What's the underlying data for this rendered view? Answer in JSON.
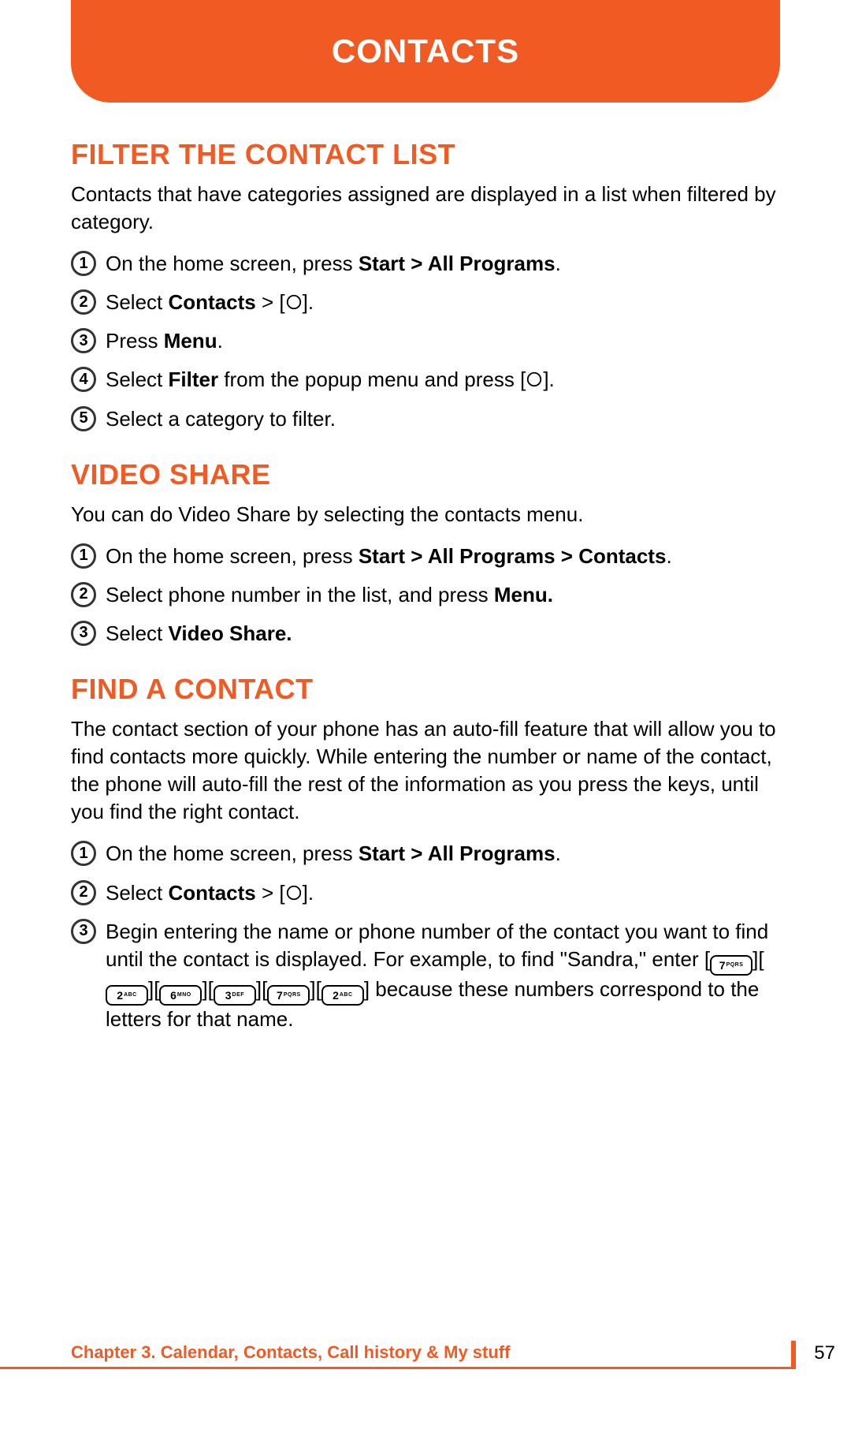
{
  "header": {
    "title": "CONTACTS"
  },
  "sections": [
    {
      "title": "FILTER THE CONTACT LIST",
      "intro": "Contacts that have categories assigned are displayed in a list when filtered by category.",
      "steps": [
        {
          "n": "1",
          "pre": "On the home screen, press ",
          "b1": "Start > All Programs",
          "post": "."
        },
        {
          "n": "2",
          "pre": "Select ",
          "b1": "Contacts",
          "mid": " > [",
          "ok": true,
          "post": "]."
        },
        {
          "n": "3",
          "pre": "Press ",
          "b1": "Menu",
          "post": "."
        },
        {
          "n": "4",
          "pre": "Select ",
          "b1": "Filter",
          "mid": " from the popup menu and press [",
          "ok": true,
          "post": "]."
        },
        {
          "n": "5",
          "pre": "Select a category to filter."
        }
      ]
    },
    {
      "title": "VIDEO SHARE",
      "intro": "You can do Video Share by selecting the contacts menu.",
      "steps": [
        {
          "n": "1",
          "pre": "On the home screen, press ",
          "b1": "Start > All Programs > Contacts",
          "post": "."
        },
        {
          "n": "2",
          "pre": "Select phone number in the list, and press ",
          "b1": "Menu.",
          "post": ""
        },
        {
          "n": "3",
          "pre": "Select ",
          "b1": "Video Share.",
          "post": ""
        }
      ]
    },
    {
      "title": "FIND A CONTACT",
      "intro": "The contact section of your phone has an auto-fill feature that will allow you to find contacts more quickly. While entering the number or name of the contact, the phone will auto-fill the rest of the information as you press the keys, until you find the right contact.",
      "steps": [
        {
          "n": "1",
          "pre": "On the home screen, press ",
          "b1": "Start > All Programs",
          "post": "."
        },
        {
          "n": "2",
          "pre": "Select ",
          "b1": "Contacts",
          "mid": " > [",
          "ok": true,
          "post": "]."
        },
        {
          "n": "3",
          "pre": "Begin entering the name or phone number of the contact you want to find until the contact is displayed. For example, to find \"Sandra,\" enter [",
          "keys": [
            {
              "d": "7",
              "l": "PQRS"
            },
            {
              "d": "2",
              "l": "ABC"
            },
            {
              "d": "6",
              "l": "MNO"
            },
            {
              "d": "3",
              "l": "DEF"
            },
            {
              "d": "7",
              "l": "PQRS"
            },
            {
              "d": "2",
              "l": "ABC"
            }
          ],
          "post": "] because these numbers correspond to the letters for that name."
        }
      ]
    }
  ],
  "footer": {
    "chapter": "Chapter 3. Calendar, Contacts, Call history & My stuff",
    "page": "57"
  }
}
